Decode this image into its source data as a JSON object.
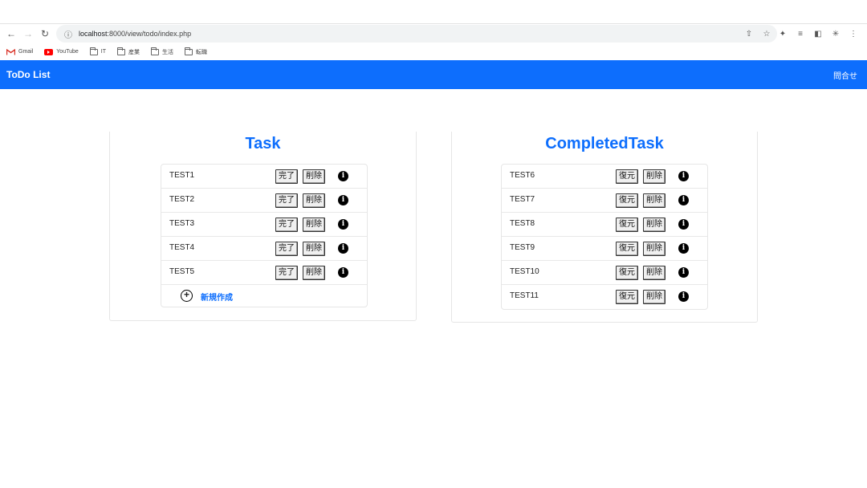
{
  "browser": {
    "url_host": "localhost",
    "url_rest": ":8000/view/todo/index.php",
    "bookmarks": [
      "Gmail",
      "YouTube",
      "IT",
      "産業",
      "生活",
      "転職"
    ]
  },
  "app": {
    "brand": "ToDo List",
    "nav_link": "問合せ"
  },
  "task_panel": {
    "title": "Task",
    "complete_label": "完了",
    "delete_label": "削除",
    "info_glyph": "i",
    "items": [
      "TEST1",
      "TEST2",
      "TEST3",
      "TEST4",
      "TEST5"
    ],
    "new_label": "新規作成"
  },
  "completed_panel": {
    "title": "CompletedTask",
    "restore_label": "復元",
    "delete_label": "削除",
    "info_glyph": "i",
    "items": [
      "TEST6",
      "TEST7",
      "TEST8",
      "TEST9",
      "TEST10",
      "TEST11"
    ]
  }
}
